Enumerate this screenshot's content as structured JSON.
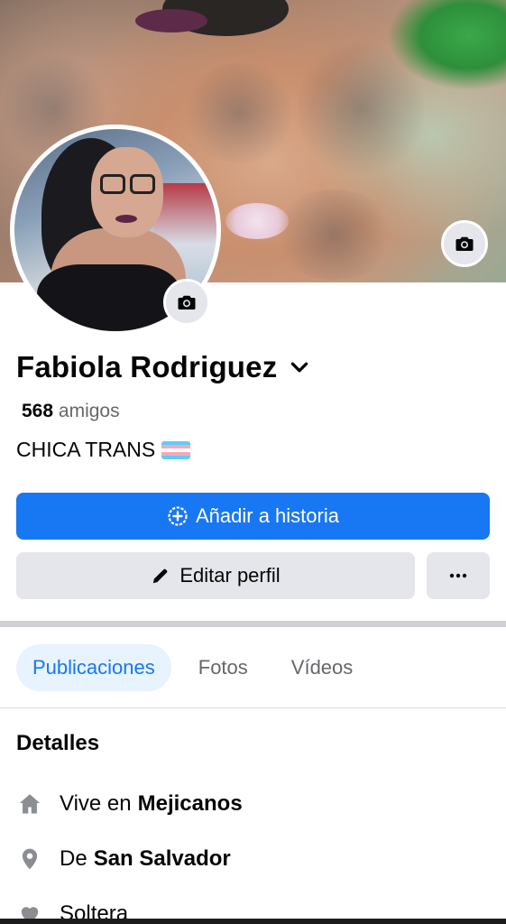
{
  "profile": {
    "name": "Fabiola Rodriguez",
    "friends_count": "568",
    "friends_label": "amigos",
    "bio": "CHICA TRANS",
    "bio_flag": "transgender-flag-emoji"
  },
  "actions": {
    "add_story_label": "Añadir a historia",
    "edit_profile_label": "Editar perfil",
    "more_label": "···"
  },
  "tabs": [
    {
      "label": "Publicaciones",
      "active": true
    },
    {
      "label": "Fotos",
      "active": false
    },
    {
      "label": "Vídeos",
      "active": false
    }
  ],
  "details": {
    "title": "Detalles",
    "items": [
      {
        "icon": "home-icon",
        "prefix": "Vive en",
        "value": "Mejicanos"
      },
      {
        "icon": "location-pin-icon",
        "prefix": "De",
        "value": "San Salvador"
      },
      {
        "icon": "heart-icon",
        "prefix": "Soltera",
        "value": ""
      }
    ]
  },
  "colors": {
    "accent": "#1877f2",
    "button_gray": "#e4e6eb",
    "text_secondary": "#65676b",
    "tab_active_bg": "#e7f3ff"
  },
  "icons": {
    "cover_camera": "camera-icon",
    "avatar_camera": "camera-icon",
    "name_dropdown": "chevron-down-icon",
    "add_story": "plus-circle-icon",
    "edit_profile": "pencil-icon",
    "more": "ellipsis-icon"
  }
}
